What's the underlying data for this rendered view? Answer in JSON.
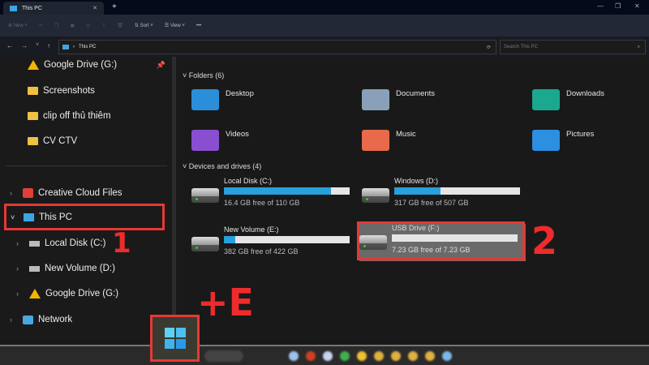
{
  "window": {
    "tab_title": "This PC",
    "new_tab": "+",
    "minimize": "—",
    "maximize": "❐",
    "close": "✕",
    "tab_close": "✕"
  },
  "toolbar": {
    "new_label": "New",
    "sort_label": "Sort",
    "view_label": "View",
    "more": "•••"
  },
  "address": {
    "path": "This PC",
    "search_placeholder": "Search This PC"
  },
  "sidebar": {
    "items": [
      {
        "label": "Google Drive (G:)",
        "icon": "google-drive-icon",
        "pinned": true
      },
      {
        "label": "Screenshots",
        "icon": "folder-icon"
      },
      {
        "label": "clip off thủ thiêm",
        "icon": "folder-icon"
      },
      {
        "label": "CV CTV",
        "icon": "folder-icon"
      },
      {
        "label": "Creative Cloud Files",
        "icon": "creative-cloud-icon"
      },
      {
        "label": "This PC",
        "icon": "monitor-icon",
        "expanded": true,
        "selected": true
      },
      {
        "label": "Local Disk (C:)",
        "icon": "drive-icon"
      },
      {
        "label": "New Volume (D:)",
        "icon": "drive-icon"
      },
      {
        "label": "Google Drive (G:)",
        "icon": "google-drive-icon"
      },
      {
        "label": "Network",
        "icon": "network-icon"
      }
    ]
  },
  "content": {
    "folders_header": "Folders (6)",
    "folders": [
      {
        "label": "Desktop",
        "color": "#2a8fd8"
      },
      {
        "label": "Documents",
        "color": "#8aa0b8"
      },
      {
        "label": "Downloads",
        "color": "#1aa88f"
      },
      {
        "label": "Videos",
        "color": "#8a4fd0"
      },
      {
        "label": "Music",
        "color": "#e86a4a"
      },
      {
        "label": "Pictures",
        "color": "#2c8fe0"
      }
    ],
    "drives_header": "Devices and drives (4)",
    "drives": [
      {
        "name": "Local Disk (C:)",
        "free": "16.4 GB free of 110 GB",
        "used_pct": 85
      },
      {
        "name": "Windows (D:)",
        "free": "317 GB free of 507 GB",
        "used_pct": 37
      },
      {
        "name": "New Volume (E:)",
        "free": "382 GB free of 422 GB",
        "used_pct": 9
      },
      {
        "name": "USB Drive (F:)",
        "free": "7.23 GB free of 7.23 GB",
        "used_pct": 0
      }
    ]
  },
  "annotations": {
    "step1": "1",
    "step2": "2",
    "shortcut": "+E"
  },
  "colors": {
    "accent": "#27a0dc",
    "highlight": "#e53935"
  }
}
